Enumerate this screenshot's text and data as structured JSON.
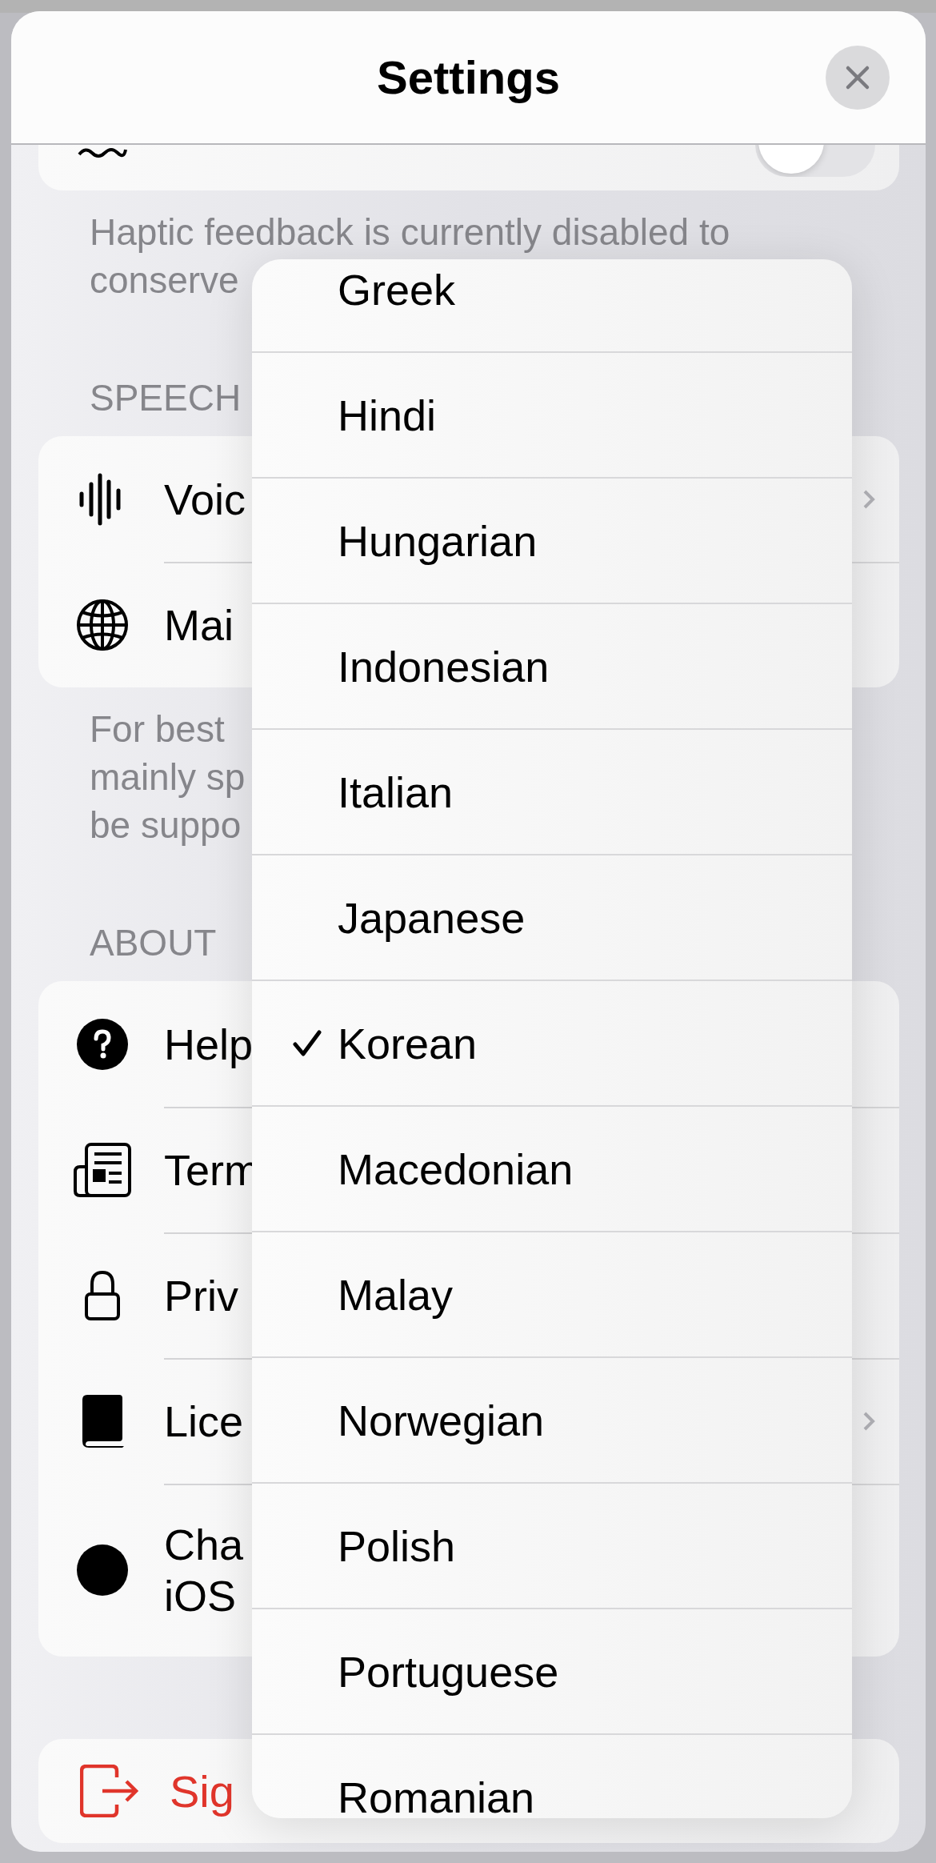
{
  "header": {
    "title": "Settings"
  },
  "sections": [
    {
      "rows": [
        {
          "kind": "toggle",
          "on": false
        }
      ],
      "footer_lines": [
        "Haptic feedback is currently disabled to",
        "conserve"
      ]
    },
    {
      "heading": "SPEECH",
      "rows": [
        {
          "label": "Voic",
          "kind": "chevron"
        },
        {
          "label": "Mai",
          "kind": "plain"
        }
      ],
      "footer_lines": [
        "For best",
        "mainly sp",
        "be suppo"
      ]
    },
    {
      "heading": "ABOUT",
      "rows": [
        {
          "label": "Help",
          "kind": "plain"
        },
        {
          "label": "Term",
          "kind": "plain"
        },
        {
          "label": "Priv",
          "kind": "plain"
        },
        {
          "label": "Lice",
          "kind": "chevron"
        },
        {
          "label": "Cha\niOS",
          "kind": "plain"
        }
      ]
    }
  ],
  "sign_out": {
    "label": "Sig"
  },
  "languages": [
    {
      "label": "Greek",
      "selected": false
    },
    {
      "label": "Hindi",
      "selected": false
    },
    {
      "label": "Hungarian",
      "selected": false
    },
    {
      "label": "Indonesian",
      "selected": false
    },
    {
      "label": "Italian",
      "selected": false
    },
    {
      "label": "Japanese",
      "selected": false
    },
    {
      "label": "Korean",
      "selected": true
    },
    {
      "label": "Macedonian",
      "selected": false
    },
    {
      "label": "Malay",
      "selected": false
    },
    {
      "label": "Norwegian",
      "selected": false
    },
    {
      "label": "Polish",
      "selected": false
    },
    {
      "label": "Portuguese",
      "selected": false
    },
    {
      "label": "Romanian",
      "selected": false
    }
  ]
}
